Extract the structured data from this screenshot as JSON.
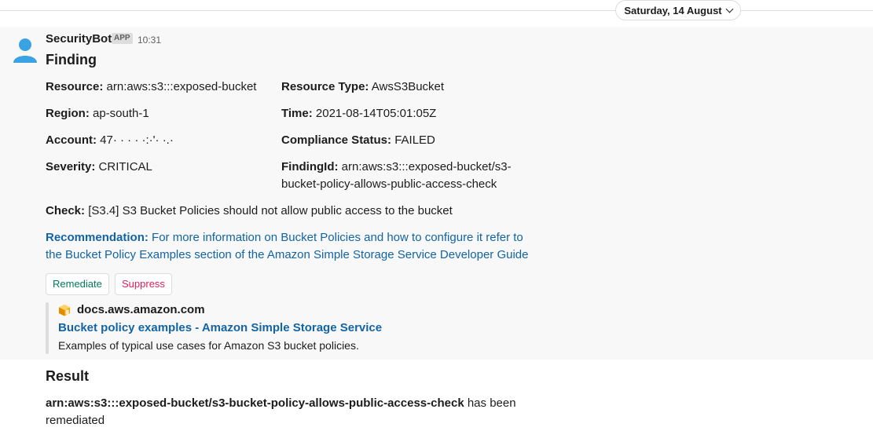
{
  "date_divider": {
    "label": "Saturday, 14 August"
  },
  "message": {
    "sender": "SecurityBot",
    "badge": "APP",
    "time": "10:31",
    "title": "Finding",
    "fields": {
      "resource": {
        "key": "Resource:",
        "value": "arn:aws:s3:::exposed-bucket"
      },
      "resource_type": {
        "key": "Resource Type:",
        "value": "AwsS3Bucket"
      },
      "region": {
        "key": "Region:",
        "value": "ap-south-1"
      },
      "time": {
        "key": "Time:",
        "value": "2021-08-14T05:01:05Z"
      },
      "account": {
        "key": "Account:",
        "value": "47·  ·  ·  ·  ·:·'·  ·.·"
      },
      "compliance": {
        "key": "Compliance Status:",
        "value": "FAILED"
      },
      "severity": {
        "key": "Severity:",
        "value": "CRITICAL"
      },
      "finding_id": {
        "key": "FindingId:",
        "line1": "arn:aws:s3:::exposed-bucket/s3-",
        "line2": "bucket-policy-allows-public-access-check"
      },
      "check": {
        "key": "Check:",
        "value": "[S3.4] S3 Bucket Policies should not allow public access to the bucket"
      }
    },
    "recommendation": {
      "key": "Recommendation:",
      "line1": "For more information on Bucket Policies and how to configure it refer to",
      "line2": "the Bucket Policy Examples section of the Amazon Simple Storage Service Developer Guide"
    },
    "buttons": {
      "remediate": "Remediate",
      "suppress": "Suppress"
    },
    "unfurl": {
      "domain": "docs.aws.amazon.com",
      "title": "Bucket policy examples - Amazon Simple Storage Service",
      "description": "Examples of typical use cases for Amazon S3 bucket policies."
    }
  },
  "result": {
    "title": "Result",
    "arn": "arn:aws:s3:::exposed-bucket/s3-bucket-policy-allows-public-access-check",
    "suffix": "has been",
    "line2": "remediated"
  },
  "colors": {
    "link": "#1264a3",
    "remediate": "#007a5a",
    "suppress": "#e01e5a",
    "avatar": "#3aa3e3"
  }
}
